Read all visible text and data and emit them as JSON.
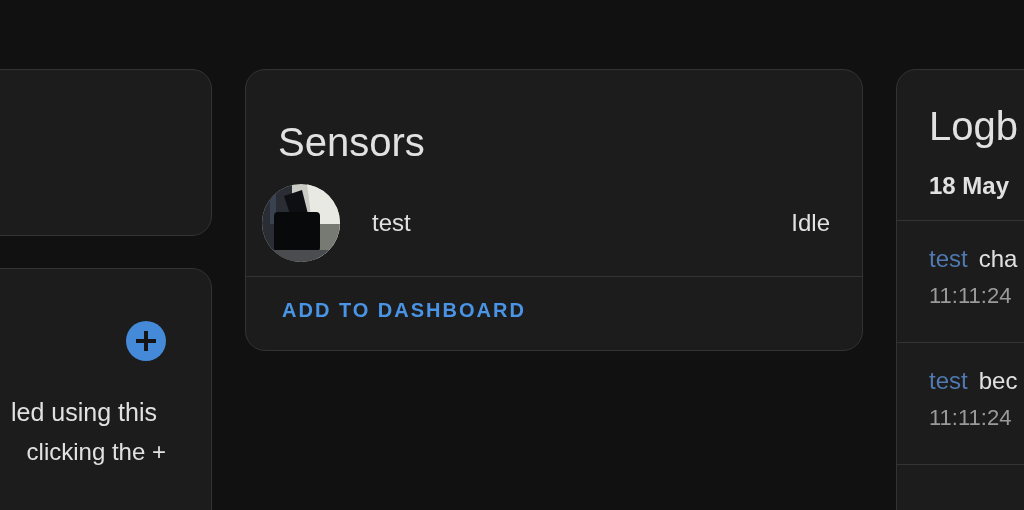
{
  "left_cards": [
    {
      "kind": "empty"
    },
    {
      "kind": "add",
      "lines": [
        "led using this",
        "clicking the +"
      ]
    }
  ],
  "sensors": {
    "title": "Sensors",
    "entities": [
      {
        "name": "test",
        "state": "Idle",
        "kind": "picture"
      }
    ],
    "action": "ADD TO DASHBOARD"
  },
  "logbook": {
    "title": "Logb",
    "date": "18 May",
    "entries": [
      {
        "entity": "test",
        "message": "cha",
        "time": "11:11:24"
      },
      {
        "entity": "test",
        "message": "bec",
        "time": "11:11:24"
      }
    ]
  }
}
